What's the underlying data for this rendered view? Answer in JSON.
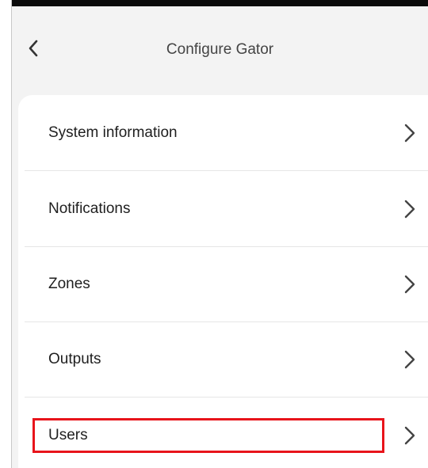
{
  "header": {
    "title": "Configure Gator",
    "back_icon": "chevron-left-icon"
  },
  "menu": {
    "items": [
      {
        "label": "System information",
        "icon": "chevron-right-icon"
      },
      {
        "label": "Notifications",
        "icon": "chevron-right-icon"
      },
      {
        "label": "Zones",
        "icon": "chevron-right-icon"
      },
      {
        "label": "Outputs",
        "icon": "chevron-right-icon"
      },
      {
        "label": "Users",
        "icon": "chevron-right-icon"
      }
    ]
  },
  "colors": {
    "background": "#f3f3f3",
    "card": "#ffffff",
    "highlight": "#e8141b",
    "text": "#1f1f1f"
  }
}
